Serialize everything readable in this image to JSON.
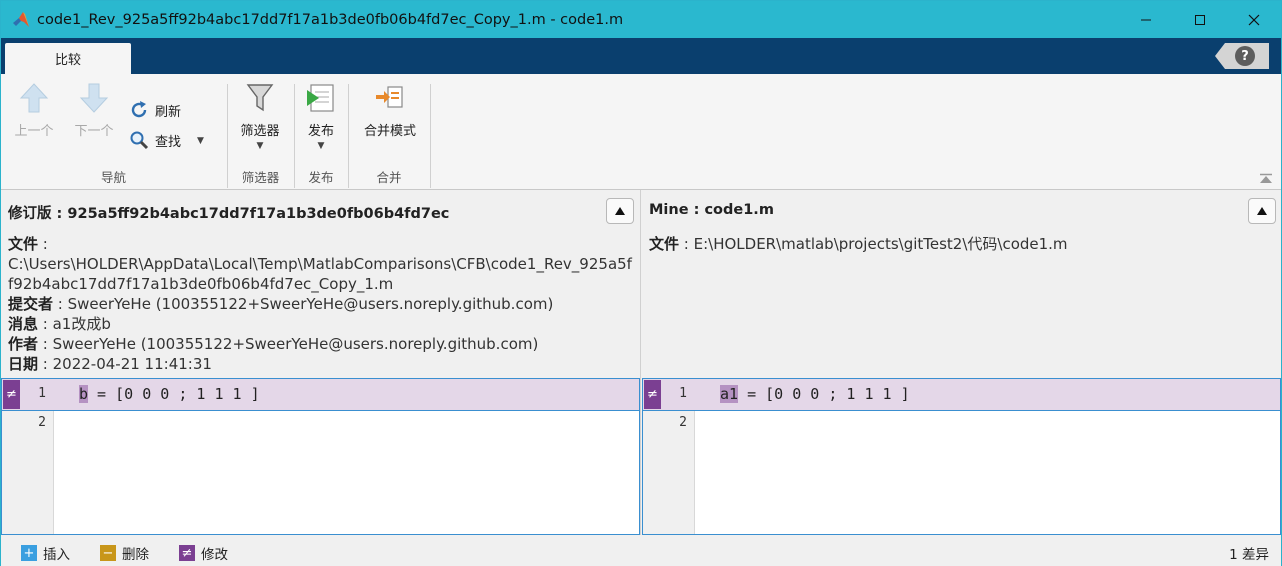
{
  "window": {
    "title": "code1_Rev_925a5ff92b4abc17dd7f17a1b3de0fb06b4fd7ec_Copy_1.m - code1.m",
    "minimize": "—",
    "maximize": "☐",
    "close": "✕"
  },
  "ribbon": {
    "tab": "比较",
    "help": "?",
    "navigation": {
      "prev": "上一个",
      "next": "下一个",
      "refresh": "刷新",
      "find": "查找",
      "group_label": "导航"
    },
    "filter": {
      "label": "筛选器",
      "group_label": "筛选器"
    },
    "publish": {
      "label": "发布",
      "group_label": "发布"
    },
    "merge": {
      "label": "合并模式",
      "group_label": "合并"
    }
  },
  "left": {
    "title": "修订版 : 925a5ff92b4abc17dd7f17a1b3de0fb06b4fd7ec",
    "file_label": "文件",
    "file_value": "C:\\Users\\HOLDER\\AppData\\Local\\Temp\\MatlabComparisons\\CFB\\code1_Rev_925a5ff92b4abc17dd7f17a1b3de0fb06b4fd7ec_Copy_1.m",
    "committer_label": "提交者",
    "committer_value": "SweerYeHe (100355122+SweerYeHe@users.noreply.github.com)",
    "message_label": "消息",
    "message_value": "a1改成b",
    "author_label": "作者",
    "author_value": "SweerYeHe (100355122+SweerYeHe@users.noreply.github.com)",
    "date_label": "日期",
    "date_value": "2022-04-21 11:41:31",
    "lines": [
      {
        "no": "1",
        "var": "b",
        "rest": " = [0 0 0 ; 1 1 1 ]"
      },
      {
        "no": "2"
      }
    ]
  },
  "right": {
    "title": "Mine : code1.m",
    "file_label": "文件",
    "file_value": "E:\\HOLDER\\matlab\\projects\\gitTest2\\代码\\code1.m",
    "lines": [
      {
        "no": "1",
        "var": "a1",
        "rest": " = [0 0 0 ; 1 1 1 ]"
      },
      {
        "no": "2"
      }
    ]
  },
  "status": {
    "insert": "插入",
    "delete": "删除",
    "modify": "修改",
    "count": "1 差异",
    "insert_symbol": "+",
    "delete_symbol": "−",
    "modify_symbol": "≠",
    "colors": {
      "insert": "#3a9fe0",
      "delete": "#c8961a",
      "modify": "#7b3f92"
    }
  }
}
